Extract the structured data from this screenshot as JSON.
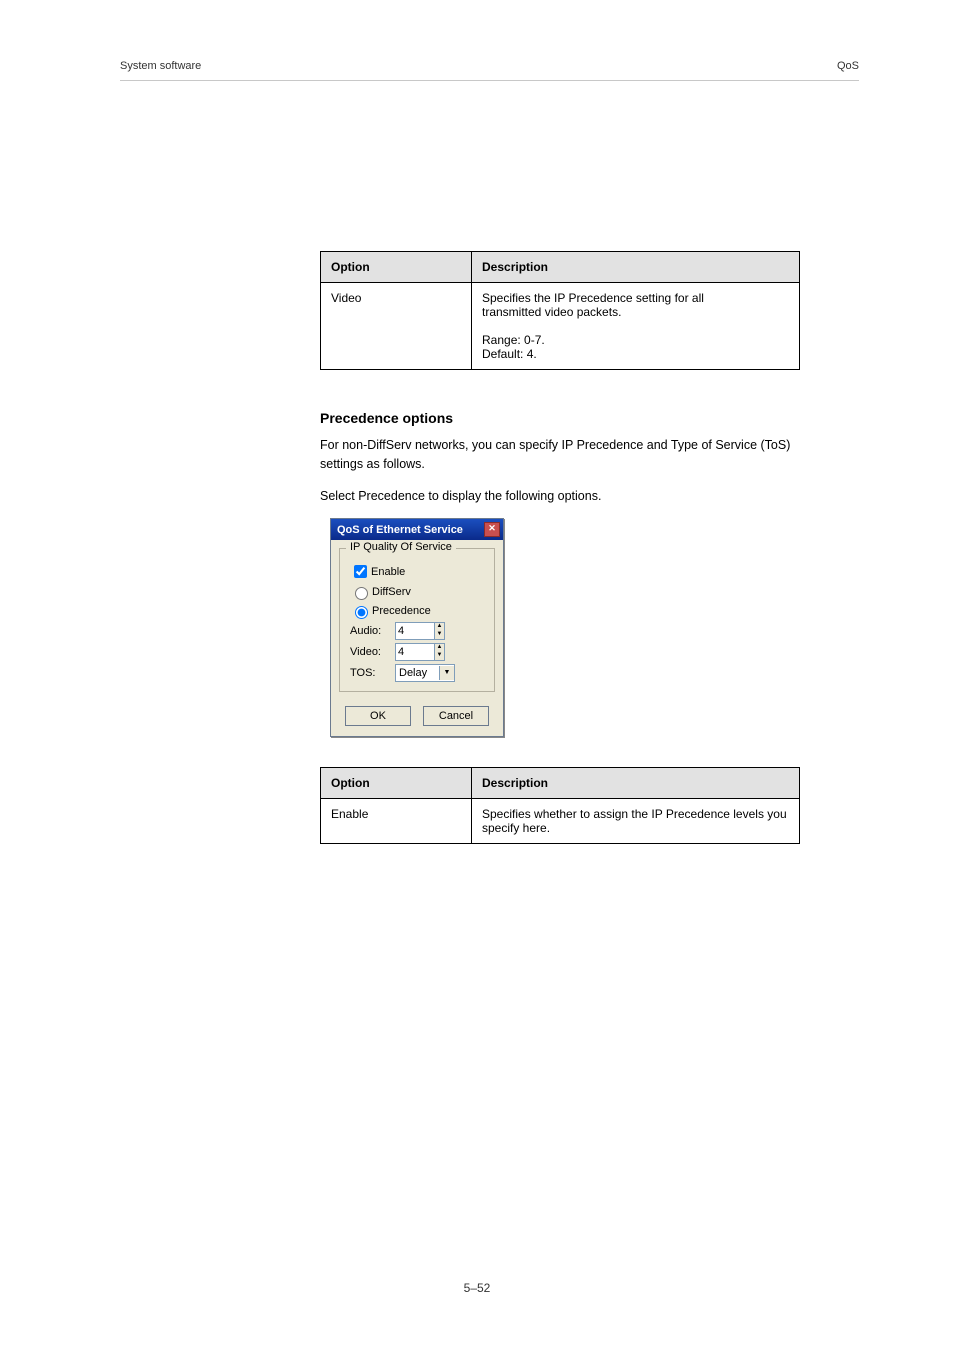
{
  "running": {
    "left": "System software",
    "right": "QoS"
  },
  "table1": {
    "headers": [
      "Option",
      "Description"
    ],
    "row_option": "Video",
    "row_desc_lines": [
      "Specifies the IP Precedence setting for all",
      "transmitted video packets.",
      "",
      "Range:  0-7.",
      "Default:  4."
    ]
  },
  "section": {
    "heading": "Precedence options",
    "p1": "For non-DiffServ networks, you can specify IP Precedence and Type of Service (ToS) settings as follows.",
    "p2": "Select Precedence to display the following options."
  },
  "dialog": {
    "title": "QoS of Ethernet Service",
    "group": "IP Quality Of Service",
    "enable": "Enable",
    "diffserv": "DiffServ",
    "precedence": "Precedence",
    "audio_label": "Audio:",
    "audio_value": "4",
    "video_label": "Video:",
    "video_value": "4",
    "tos_label": "TOS:",
    "tos_value": "Delay",
    "ok": "OK",
    "cancel": "Cancel"
  },
  "table2": {
    "headers": [
      "Option",
      "Description"
    ],
    "row_option": "Enable",
    "row_desc": "Specifies whether to assign the IP Precedence levels you specify here."
  },
  "footer": "5–52"
}
